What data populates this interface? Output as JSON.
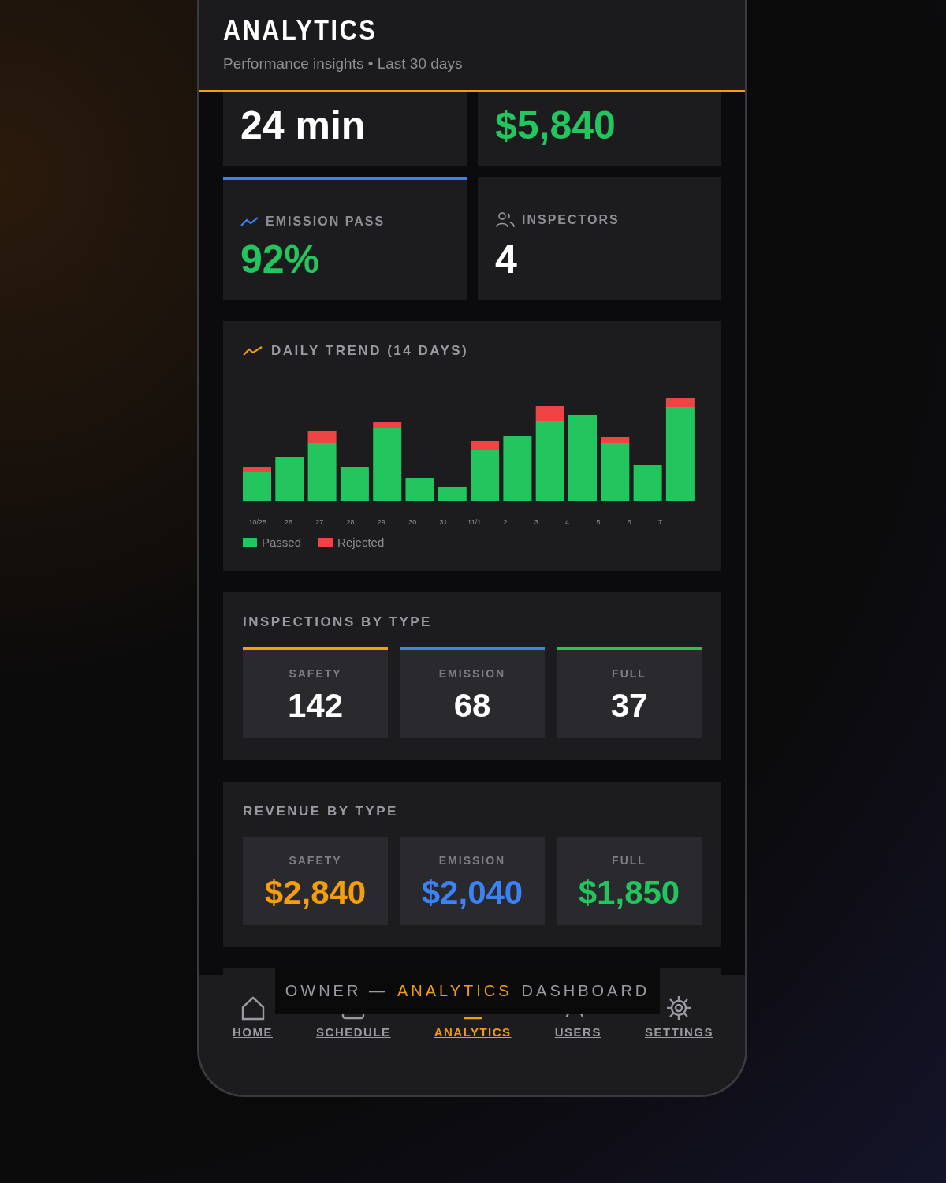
{
  "header": {
    "title": "ANALYTICS",
    "subtitle": "Performance insights • Last 30 days"
  },
  "stat_cards": [
    {
      "value": "24 min",
      "color": "#ffffff"
    },
    {
      "value": "$5,840",
      "color": "#22c55e"
    },
    {
      "label": "EMISSION PASS",
      "value": "92%",
      "color": "#22c55e",
      "accented": true
    },
    {
      "label": "INSPECTORS",
      "value": "4",
      "color": "#ffffff",
      "accented": false
    }
  ],
  "daily_trend": {
    "title": "DAILY TREND (14 DAYS)",
    "x_labels": [
      "10/25",
      "26",
      "27",
      "28",
      "29",
      "30",
      "31",
      "11/1",
      "2",
      "3",
      "4",
      "5",
      "6",
      "7"
    ],
    "legend": [
      {
        "label": "Passed",
        "color": "#22c55e"
      },
      {
        "label": "Rejected",
        "color": "#ef4444"
      }
    ]
  },
  "inspections_by_type": {
    "title": "INSPECTIONS BY TYPE",
    "items": [
      {
        "label": "SAFETY",
        "value": "142",
        "color": "#f59e0b"
      },
      {
        "label": "EMISSION",
        "value": "68",
        "color": "#3b82f6"
      },
      {
        "label": "FULL",
        "value": "37",
        "color": "#22c55e"
      }
    ]
  },
  "revenue_by_type": {
    "title": "REVENUE BY TYPE",
    "items": [
      {
        "label": "SAFETY",
        "value": "$2,840",
        "color": "#f59e0b"
      },
      {
        "label": "EMISSION",
        "value": "$2,040",
        "color": "#3b82f6"
      },
      {
        "label": "FULL",
        "value": "$1,850",
        "color": "#22c55e"
      }
    ]
  },
  "bottom_nav": [
    {
      "label": "HOME",
      "selected": false
    },
    {
      "label": "SCHEDULE",
      "selected": false
    },
    {
      "label": "ANALYTICS",
      "selected": true
    },
    {
      "label": "USERS",
      "selected": false
    },
    {
      "label": "SETTINGS",
      "selected": false
    }
  ],
  "caption": [
    {
      "text": "OWNER —",
      "highlighted": false
    },
    {
      "text": "ANALYTICS",
      "highlighted": true
    },
    {
      "text": "DASHBOARD",
      "highlighted": false
    }
  ]
}
